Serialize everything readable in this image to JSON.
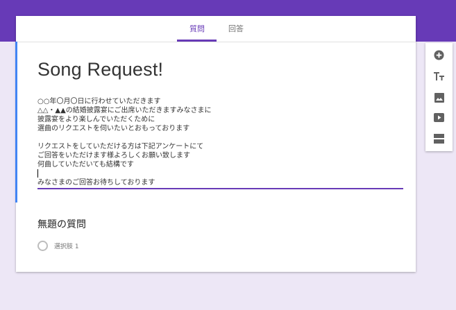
{
  "tabs": [
    {
      "label": "質問",
      "active": true
    },
    {
      "label": "回答",
      "active": false
    }
  ],
  "form": {
    "title": "Song Request!",
    "description_lines": [
      "○○年〇月〇日に行わせていただきます",
      "△△・▲▲の結婚披露宴にご出席いただきますみなさまに",
      "披露宴をより楽しんでいただくために",
      "選曲のリクエストを伺いたいとおもっております",
      "",
      "リクエストをしていただける方は下記アンケートにて",
      "ご回答をいただけます様よろしくお願い致します",
      "何曲していただいても結構です",
      "",
      "みなさまのご回答お待ちしております"
    ]
  },
  "question": {
    "title": "無題の質問",
    "options": [
      "選択肢 1"
    ]
  },
  "toolbar": [
    "add-question-icon",
    "add-title-icon",
    "add-image-icon",
    "add-video-icon",
    "add-section-icon"
  ],
  "colors": {
    "accent": "#673ab7",
    "background": "#ede7f6",
    "focus_bar": "#4285f4"
  }
}
